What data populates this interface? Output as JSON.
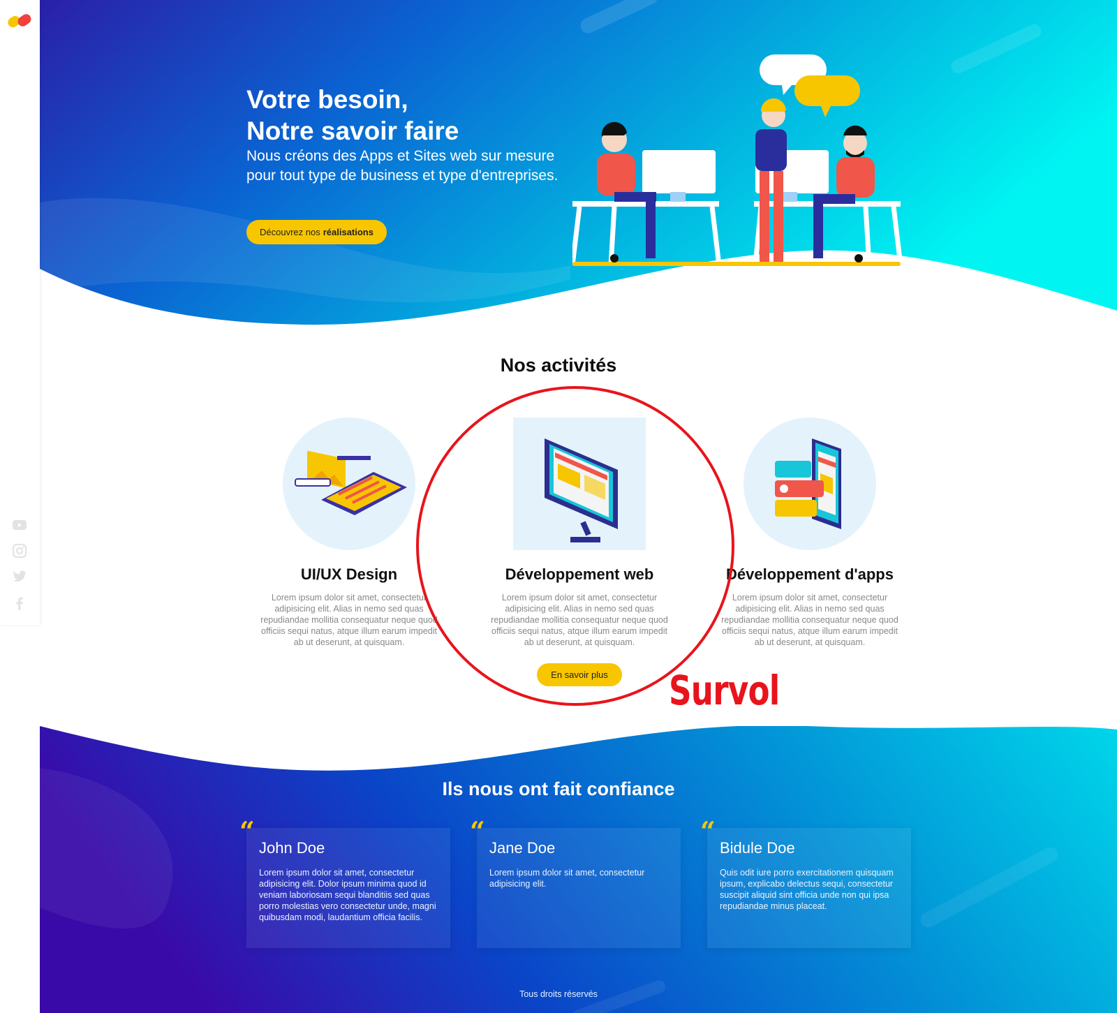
{
  "hero": {
    "title_line1": "Votre besoin,",
    "title_line2": "Notre savoir faire",
    "subtitle": "Nous créons des Apps et Sites web sur mesure pour tout type de business et type d'entreprises.",
    "cta_prefix": "Découvrez nos",
    "cta_bold": "réalisations"
  },
  "activities": {
    "title": "Nos activités",
    "items": [
      {
        "name": "UI/UX Design",
        "text": "Lorem ipsum dolor sit amet, consectetur adipisicing elit. Alias in nemo sed quas repudiandae mollitia consequatur neque quod officiis sequi natus, atque illum earum impedit ab ut deserunt, at quisquam.",
        "icon": "phone-design-icon"
      },
      {
        "name": "Développement web",
        "text": "Lorem ipsum dolor sit amet, consectetur adipisicing elit. Alias in nemo sed quas repudiandae mollitia consequatur neque quod officiis sequi natus, atque illum earum impedit ab ut deserunt, at quisquam.",
        "button": "En savoir plus",
        "icon": "monitor-icon"
      },
      {
        "name": "Développement d'apps",
        "text": "Lorem ipsum dolor sit amet, consectetur adipisicing elit. Alias in nemo sed quas repudiandae mollitia consequatur neque quod officiis sequi natus, atque illum earum impedit ab ut deserunt, at quisquam.",
        "icon": "mobile-app-icon"
      }
    ],
    "hover_annotation": "Survol"
  },
  "testimonials": {
    "title": "Ils nous ont fait confiance",
    "quote_mark": "“",
    "items": [
      {
        "name": "John Doe",
        "text": "Lorem ipsum dolor sit amet, consectetur adipisicing elit. Dolor ipsum minima quod id veniam laboriosam sequi blanditiis sed quas porro molestias vero consectetur unde, magni quibusdam modi, laudantium officia facilis."
      },
      {
        "name": "Jane Doe",
        "text": "Lorem ipsum dolor sit amet, consectetur adipisicing elit."
      },
      {
        "name": "Bidule Doe",
        "text": "Quis odit iure porro exercitationem quisquam ipsum, explicabo delectus sequi, consectetur suscipit aliquid sint officia unde non qui ipsa repudiandae minus placeat."
      }
    ]
  },
  "footer": {
    "copyright": "Tous droits réservés"
  },
  "sidebar": {
    "social": [
      "youtube-icon",
      "instagram-icon",
      "twitter-icon",
      "facebook-icon"
    ]
  },
  "colors": {
    "accent": "#f7c600",
    "blue_dark": "#2a1fa8",
    "cyan": "#00f0f0",
    "hover_red": "#e8141c"
  }
}
